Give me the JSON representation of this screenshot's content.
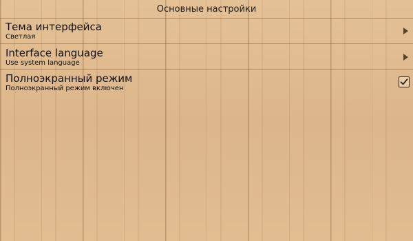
{
  "header": {
    "title": "Основные настройки"
  },
  "settings": [
    {
      "title": "Тема интерфейса",
      "summary": "Светлая",
      "widget": "chevron-right-icon"
    },
    {
      "title": "Interface language",
      "summary": "Use system language",
      "widget": "chevron-right-icon"
    },
    {
      "title": "Полноэкранный режим",
      "summary": "Полноэкранный режим включен",
      "widget": "checkbox",
      "checked": true
    }
  ],
  "colors": {
    "background": "#ddb486",
    "divider": "#78502a",
    "text": "#111111"
  }
}
